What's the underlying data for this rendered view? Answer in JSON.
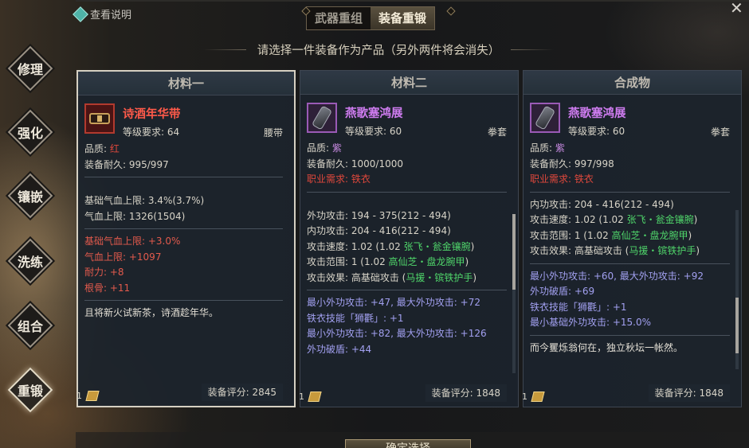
{
  "help": {
    "label": "查看说明"
  },
  "tabs": [
    {
      "label": "武器重组",
      "active": false
    },
    {
      "label": "装备重锻",
      "active": true
    }
  ],
  "subtitle": "请选择一件装备作为产品（另外两件将会消失）",
  "side_nav": [
    {
      "label": "修理"
    },
    {
      "label": "强化"
    },
    {
      "label": "镶嵌"
    },
    {
      "label": "洗练"
    },
    {
      "label": "组合"
    },
    {
      "label": "重锻",
      "active": true
    }
  ],
  "panels": [
    {
      "header": "材料一",
      "name": "诗酒年华带",
      "name_color": "red",
      "level": "等级要求: 64",
      "slot": "腰带",
      "quality_label": "品质: ",
      "quality_value": "红",
      "durability": "装备耐久: 995/997",
      "base": [
        "基础气血上限: 3.4%(3.7%)",
        "气血上限: 1326(1504)"
      ],
      "extra": [
        "基础气血上限: +3.0%",
        "气血上限: +1097",
        "耐力: +8",
        "根骨: +11"
      ],
      "desc": "且将新火试新茶，诗酒趁年华。",
      "count": "1",
      "score": "装备评分: 2845"
    },
    {
      "header": "材料二",
      "name": "燕歌塞鸿展",
      "name_color": "purple",
      "level": "等级要求: 60",
      "slot": "拳套",
      "quality_label": "品质: ",
      "quality_value": "紫",
      "durability": "装备耐久: 1000/1000",
      "class_label": "职业需求: ",
      "class_value": "铁衣",
      "stats": [
        "外功攻击: 194 - 375(212 - 494)",
        "内功攻击: 204 - 416(212 - 494)"
      ],
      "speed_prefix": "攻击速度: 1.02 (1.02 ",
      "speed_green": "张飞・瓮金镶腕",
      "speed_suffix": ")",
      "range_prefix": "攻击范围: 1 (1.02 ",
      "range_green": "高仙芝・盘龙腕甲",
      "range_suffix": ")",
      "effect_prefix": "攻击效果: 高基础攻击 (",
      "effect_green": "马援・镔铁护手",
      "effect_suffix": ")",
      "blue": [
        "最小外功攻击: +47, 最大外功攻击: +72",
        "铁衣技能「狮氍」: +1",
        "最小外功攻击: +82, 最大外功攻击: +126",
        "外功破盾: +44"
      ],
      "count": "1",
      "score": "装备评分: 1848"
    },
    {
      "header": "合成物",
      "name": "燕歌塞鸿展",
      "name_color": "purple",
      "level": "等级要求: 60",
      "slot": "拳套",
      "quality_label": "品质: ",
      "quality_value": "紫",
      "durability": "装备耐久: 997/998",
      "class_label": "职业需求: ",
      "class_value": "铁衣",
      "stats": [
        "内功攻击: 204 - 416(212 - 494)"
      ],
      "speed_prefix": "攻击速度: 1.02 (1.02 ",
      "speed_green": "张飞・瓮金镶腕",
      "speed_suffix": ")",
      "range_prefix": "攻击范围: 1 (1.02 ",
      "range_green": "高仙芝・盘龙腕甲",
      "range_suffix": ")",
      "effect_prefix": "攻击效果: 高基础攻击 (",
      "effect_green": "马援・镔铁护手",
      "effect_suffix": ")",
      "blue": [
        "最小外功攻击: +60, 最大外功攻击: +92",
        "外功破盾: +69",
        "铁衣技能「狮氍」: +1",
        "最小基础外功攻击: +15.0%"
      ],
      "desc": "而今矍烁翁何在，独立秋坛一帐然。",
      "count": "1",
      "score": "装备评分: 1848"
    }
  ],
  "confirm": {
    "label": "确定选择"
  }
}
